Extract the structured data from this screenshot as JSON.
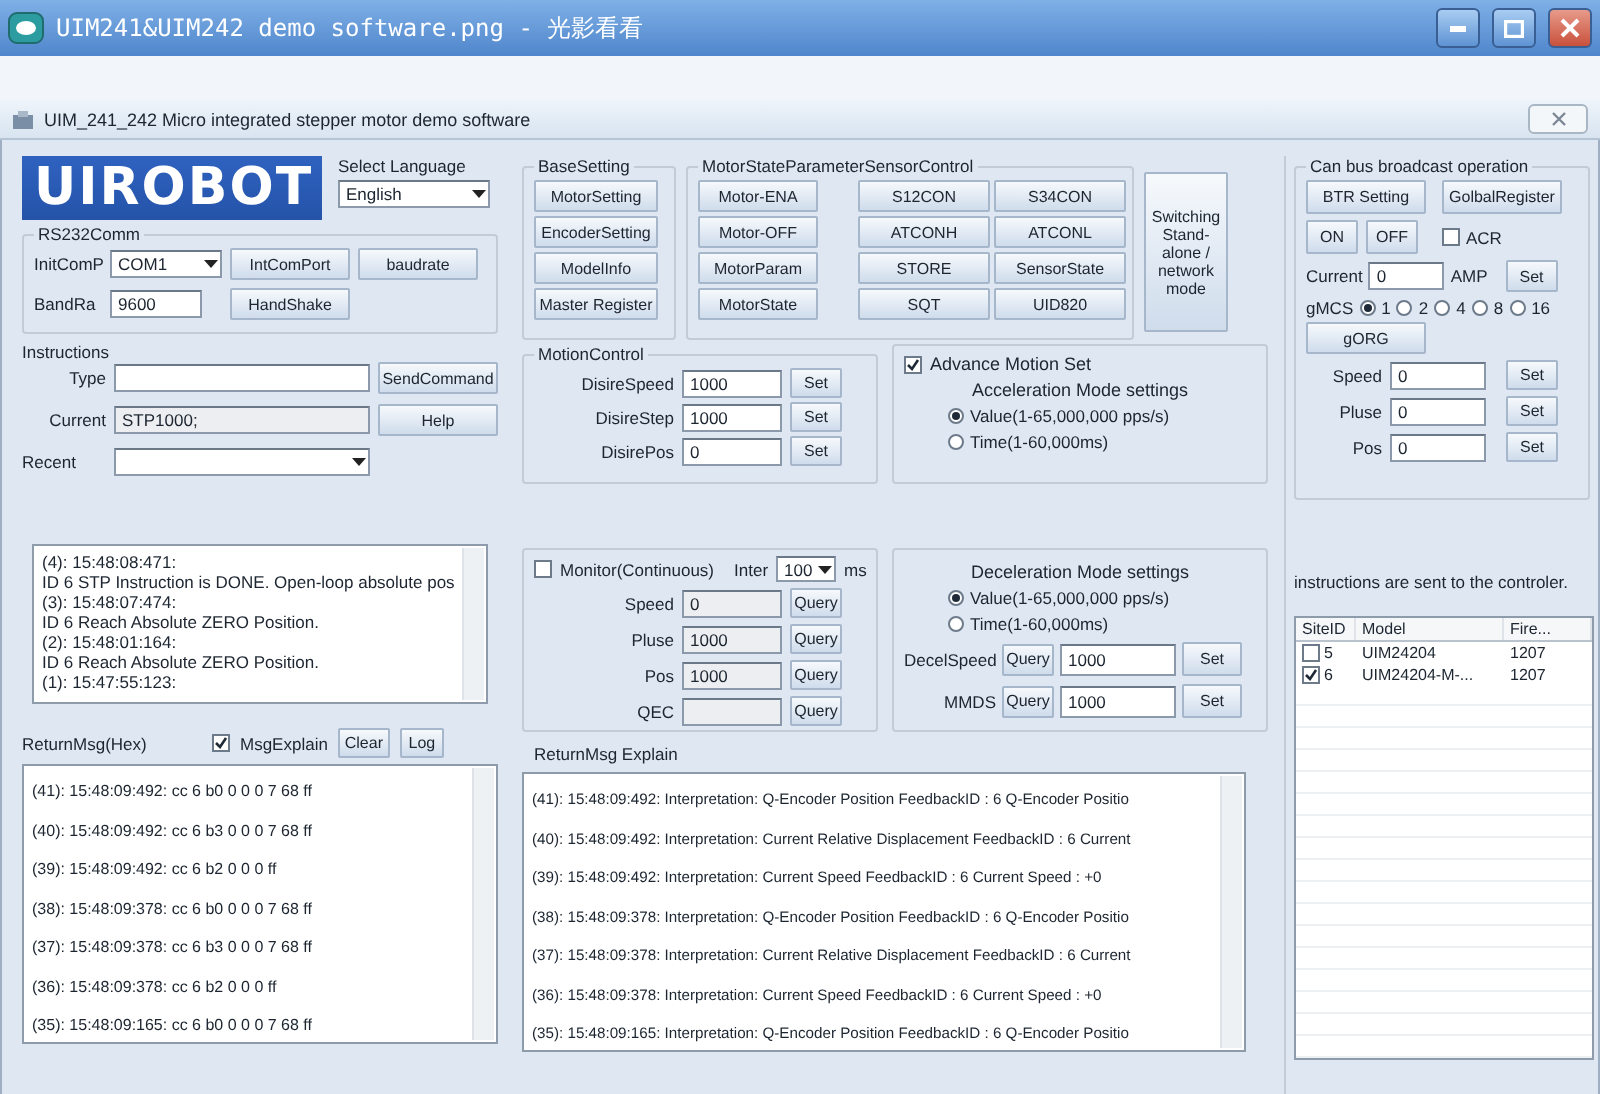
{
  "viewer": {
    "title": "UIM241&UIM242 demo software.png - 光影看看"
  },
  "app": {
    "title": "UIM_241_242 Micro integrated stepper motor demo software"
  },
  "logo": "UIROBOT",
  "language": {
    "label": "Select Language",
    "value": "English"
  },
  "rs232": {
    "legend": "RS232Comm",
    "port_label": "InitComP",
    "port": "COM1",
    "baud_label": "BandRa",
    "baud": "9600",
    "buttons": [
      "IntComPort",
      "baudrate",
      "HandShake"
    ]
  },
  "instructions": {
    "title": "Instructions",
    "type_label": "Type",
    "current_label": "Current",
    "current": "STP1000;",
    "recent_label": "Recent",
    "buttons": [
      "SendCommand",
      "Help"
    ]
  },
  "log": [
    "(4): 15:48:08:471:",
    "ID 6 STP Instruction is DONE. Open-loop absolute pos",
    "(3): 15:48:07:474:",
    "ID 6  Reach Absolute ZERO Position.",
    "(2): 15:48:01:164:",
    "ID 6  Reach Absolute ZERO Position.",
    "(1): 15:47:55:123:"
  ],
  "base_setting": {
    "legend": "BaseSetting",
    "buttons": [
      "MotorSetting",
      "EncoderSetting",
      "ModelInfo",
      "Master Register"
    ]
  },
  "motor_state": {
    "legend": "MotorStateParameterSensorControl",
    "buttons": [
      "Motor-ENA",
      "S12CON",
      "S34CON",
      "Motor-OFF",
      "ATCONH",
      "ATCONL",
      "MotorParam",
      "STORE",
      "SensorState",
      "MotorState",
      "SQT",
      "UID820"
    ]
  },
  "switch_mode": "Switching Stand-alone / network mode",
  "motion_control": {
    "legend": "MotionControl",
    "rows": [
      {
        "label": "DisireSpeed",
        "value": "1000",
        "button": "Set"
      },
      {
        "label": "DisireStep",
        "value": "1000",
        "button": "Set"
      },
      {
        "label": "DisirePos",
        "value": "0",
        "button": "Set"
      }
    ]
  },
  "advance": {
    "label": "Advance Motion Set",
    "checked": true,
    "title": "Acceleration Mode settings",
    "options": [
      {
        "label": "Value(1-65,000,000 pps/s)",
        "selected": true
      },
      {
        "label": "Time(1-60,000ms)",
        "selected": false
      }
    ]
  },
  "monitor": {
    "label": "Monitor(Continuous)",
    "checked": false,
    "interval_label": "Inter",
    "interval": "100",
    "unit": "ms",
    "rows": [
      {
        "label": "Speed",
        "value": "0",
        "button": "Query"
      },
      {
        "label": "Pluse",
        "value": "1000",
        "button": "Query"
      },
      {
        "label": "Pos",
        "value": "1000",
        "button": "Query"
      },
      {
        "label": "QEC",
        "button": "Query"
      }
    ]
  },
  "deceleration": {
    "title": "Deceleration Mode settings",
    "options": [
      {
        "label": "Value(1-65,000,000 pps/s)",
        "selected": true
      },
      {
        "label": "Time(1-60,000ms)",
        "selected": false
      }
    ],
    "rows": [
      {
        "label": "DecelSpeed",
        "query": "Query",
        "value": "1000",
        "button": "Set"
      },
      {
        "label": "MMDS",
        "query": "Query",
        "value": "1000",
        "button": "Set"
      }
    ]
  },
  "return_hex": {
    "label": "ReturnMsg(Hex)",
    "explain": {
      "label": "MsgExplain",
      "checked": true
    },
    "buttons": [
      "Clear",
      "Log"
    ],
    "lines": [
      "(41): 15:48:09:492: cc 6 b0 0 0 0 7 68 ff",
      "(40): 15:48:09:492: cc 6 b3 0 0 0 7 68 ff",
      "(39): 15:48:09:492: cc 6 b2 0 0 0 ff",
      "(38): 15:48:09:378: cc 6 b0 0 0 0 7 68 ff",
      "(37): 15:48:09:378: cc 6 b3 0 0 0 7 68 ff",
      "(36): 15:48:09:378: cc 6 b2 0 0 0 ff",
      "(35): 15:48:09:165: cc 6 b0 0 0 0 7 68 ff"
    ]
  },
  "return_explain": {
    "label": "ReturnMsg Explain",
    "lines": [
      "(41): 15:48:09:492: Interpretation: Q-Encoder Position FeedbackID : 6 Q-Encoder Positio",
      "(40): 15:48:09:492: Interpretation: Current Relative Displacement FeedbackID : 6 Current",
      "(39): 15:48:09:492: Interpretation: Current Speed FeedbackID : 6 Current Speed : +0",
      "(38): 15:48:09:378: Interpretation: Q-Encoder Position FeedbackID : 6 Q-Encoder Positio",
      "(37): 15:48:09:378: Interpretation: Current Relative Displacement FeedbackID : 6 Current",
      "(36): 15:48:09:378: Interpretation: Current Speed FeedbackID : 6 Current Speed : +0",
      "(35): 15:48:09:165: Interpretation: Q-Encoder Position FeedbackID : 6 Q-Encoder Positio"
    ]
  },
  "can_bus": {
    "legend": "Can bus broadcast operation",
    "buttons": [
      "BTR Setting",
      "GolbalRegister"
    ],
    "on": "ON",
    "off": "OFF",
    "acr": {
      "label": "ACR",
      "checked": false
    },
    "current": {
      "label": "Current",
      "value": "0",
      "unit": "AMP",
      "button": "Set"
    },
    "gmcs": {
      "label": "gMCS",
      "options": [
        {
          "label": "1",
          "selected": true
        },
        {
          "label": "2",
          "selected": false
        },
        {
          "label": "4",
          "selected": false
        },
        {
          "label": "8",
          "selected": false
        },
        {
          "label": "16",
          "selected": false
        }
      ]
    },
    "gorg": "gORG",
    "rows": [
      {
        "label": "Speed",
        "value": "0",
        "button": "Set"
      },
      {
        "label": "Pluse",
        "value": "0",
        "button": "Set"
      },
      {
        "label": "Pos",
        "value": "0",
        "button": "Set"
      }
    ]
  },
  "site_note": "instructions are sent to the controler.",
  "site_table": {
    "columns": [
      "SiteID",
      "Model",
      "Fire..."
    ],
    "rows": [
      {
        "checked": false,
        "cells": [
          "5",
          "UIM24204",
          "1207"
        ]
      },
      {
        "checked": true,
        "cells": [
          "6",
          "UIM24204-M-...",
          "1207"
        ]
      }
    ]
  }
}
